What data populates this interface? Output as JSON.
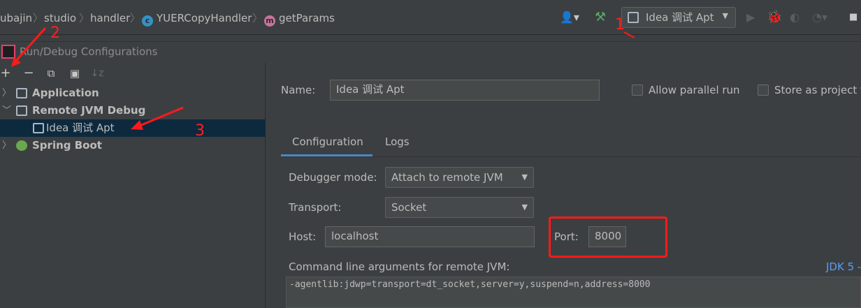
{
  "breadcrumbs": [
    {
      "label": "ubajin"
    },
    {
      "label": "studio"
    },
    {
      "label": "handler"
    },
    {
      "label": "YUERCopyHandler",
      "badge": "c"
    },
    {
      "label": "getParams",
      "badge": "m"
    }
  ],
  "toolbar": {
    "run_config_label": "Idea 调试 Apt",
    "icons": [
      "user-icon",
      "build-hammer-icon",
      "run-icon",
      "debug-icon",
      "coverage-icon",
      "profile-icon",
      "stop-icon"
    ]
  },
  "dialog": {
    "title": "Run/Debug Configurations"
  },
  "left_toolbar": {
    "add": "+",
    "remove": "−"
  },
  "tree": [
    {
      "label": "Application",
      "expanded": false
    },
    {
      "label": "Remote JVM Debug",
      "expanded": true
    },
    {
      "label": "Idea 调试 Apt",
      "selected": true
    },
    {
      "label": "Spring Boot",
      "expanded": false
    }
  ],
  "form": {
    "name_label": "Name:",
    "name_value": "Idea 调试 Apt",
    "allow_parallel_label": "Allow parallel run",
    "store_as_project_label": "Store as project f",
    "tabs": [
      "Configuration",
      "Logs"
    ],
    "debugger_mode_label": "Debugger mode:",
    "debugger_mode_value": "Attach to remote JVM",
    "transport_label": "Transport:",
    "transport_value": "Socket",
    "host_label": "Host:",
    "host_value": "localhost",
    "port_label": "Port:",
    "port_value": "8000",
    "cmd_label": "Command line arguments for remote JVM:",
    "jdk_link": "JDK 5 -",
    "cmd_value": "-agentlib:jdwp=transport=dt_socket,server=y,suspend=n,address=8000"
  },
  "annotations": {
    "one": "1",
    "two": "2",
    "three": "3",
    "color": "#ff1a1a"
  }
}
